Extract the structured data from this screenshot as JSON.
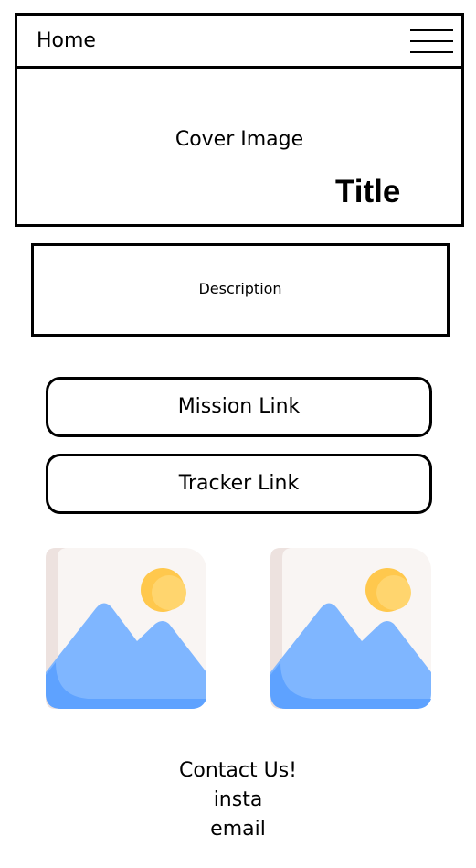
{
  "header": {
    "home_label": "Home",
    "menu_icon": "hamburger-menu-icon"
  },
  "cover": {
    "label": "Cover Image",
    "title": "Title"
  },
  "description": {
    "label": "Description"
  },
  "links": {
    "mission": "Mission Link",
    "tracker": "Tracker Link"
  },
  "gallery": {
    "items": [
      {
        "icon": "image-placeholder-icon"
      },
      {
        "icon": "image-placeholder-icon"
      }
    ]
  },
  "contact": {
    "heading": "Contact Us!",
    "insta": "insta",
    "email": "email"
  },
  "colors": {
    "border": "#000000",
    "background": "#ffffff",
    "image_bg": "#F9F5F3",
    "image_shadow": "#EDE2DF",
    "sun": "#FFC84D",
    "sun_highlight": "#FFD56E",
    "mountain": "#7FB6FF",
    "mountain_shadow": "#5EA2FF"
  }
}
